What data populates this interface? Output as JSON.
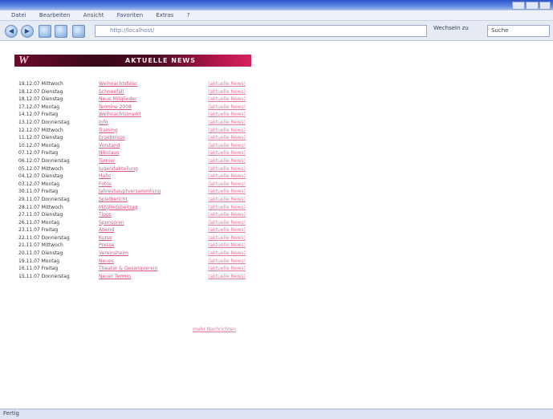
{
  "window": {
    "title": ""
  },
  "menu": {
    "items": [
      "Datei",
      "Bearbeiten",
      "Ansicht",
      "Favoriten",
      "Extras",
      "?"
    ]
  },
  "toolbar": {
    "back": "◀",
    "forward": "▶",
    "address": "http://localhost/",
    "go": "Wechseln zu",
    "search_value": "Suche"
  },
  "banner": {
    "logo": "W",
    "name": "AKTUELLE NEWS",
    "sub": ""
  },
  "news": [
    {
      "dt": "19.12.07 Mittwoch",
      "title": "Weihnachtsfeier",
      "src": "(aktuelle News)"
    },
    {
      "dt": "18.12.07 Dienstag",
      "title": "Schneefall",
      "src": "(aktuelle News)"
    },
    {
      "dt": "18.12.07 Dienstag",
      "title": "Neue Mitglieder",
      "src": "(aktuelle News)"
    },
    {
      "dt": "17.12.07 Montag",
      "title": "Termine 2008",
      "src": "(aktuelle News)"
    },
    {
      "dt": "14.12.07 Freitag",
      "title": "Weihnachtsmarkt",
      "src": "(aktuelle News)"
    },
    {
      "dt": "13.12.07 Donnerstag",
      "title": "Info",
      "src": "(aktuelle News)"
    },
    {
      "dt": "12.12.07 Mittwoch",
      "title": "Training",
      "src": "(aktuelle News)"
    },
    {
      "dt": "11.12.07 Dienstag",
      "title": "Ergebnisse",
      "src": "(aktuelle News)"
    },
    {
      "dt": "10.12.07 Montag",
      "title": "Vorstand",
      "src": "(aktuelle News)"
    },
    {
      "dt": "07.12.07 Freitag",
      "title": "Nikolaus",
      "src": "(aktuelle News)"
    },
    {
      "dt": "06.12.07 Donnerstag",
      "title": "Turnier",
      "src": "(aktuelle News)"
    },
    {
      "dt": "05.12.07 Mittwoch",
      "title": "Jugendabteilung",
      "src": "(aktuelle News)"
    },
    {
      "dt": "04.12.07 Dienstag",
      "title": "Hallo",
      "src": "(aktuelle News)"
    },
    {
      "dt": "03.12.07 Montag",
      "title": "Fotos",
      "src": "(aktuelle News)"
    },
    {
      "dt": "30.11.07 Freitag",
      "title": "Jahreshauptversammlung",
      "src": "(aktuelle News)"
    },
    {
      "dt": "29.11.07 Donnerstag",
      "title": "Spielbericht",
      "src": "(aktuelle News)"
    },
    {
      "dt": "28.11.07 Mittwoch",
      "title": "Mitgliedsbeitrag",
      "src": "(aktuelle News)"
    },
    {
      "dt": "27.11.07 Dienstag",
      "title": "Tipps",
      "src": "(aktuelle News)"
    },
    {
      "dt": "26.11.07 Montag",
      "title": "Sponsoren",
      "src": "(aktuelle News)"
    },
    {
      "dt": "23.11.07 Freitag",
      "title": "Abend",
      "src": "(aktuelle News)"
    },
    {
      "dt": "22.11.07 Donnerstag",
      "title": "Kurse",
      "src": "(aktuelle News)"
    },
    {
      "dt": "21.11.07 Mittwoch",
      "title": "Presse",
      "src": "(aktuelle News)"
    },
    {
      "dt": "20.11.07 Dienstag",
      "title": "Vereinsheim",
      "src": "(aktuelle News)"
    },
    {
      "dt": "19.11.07 Montag",
      "title": "Neues",
      "src": "(aktuelle News)"
    },
    {
      "dt": "16.11.07 Freitag",
      "title": "Theater & Gesangverein",
      "src": "(aktuelle News)"
    },
    {
      "dt": "15.11.07 Donnerstag",
      "title": "Neuer Termin",
      "src": "(aktuelle News)"
    }
  ],
  "more_link": "mehr Nachrichten",
  "status": "Fertig"
}
